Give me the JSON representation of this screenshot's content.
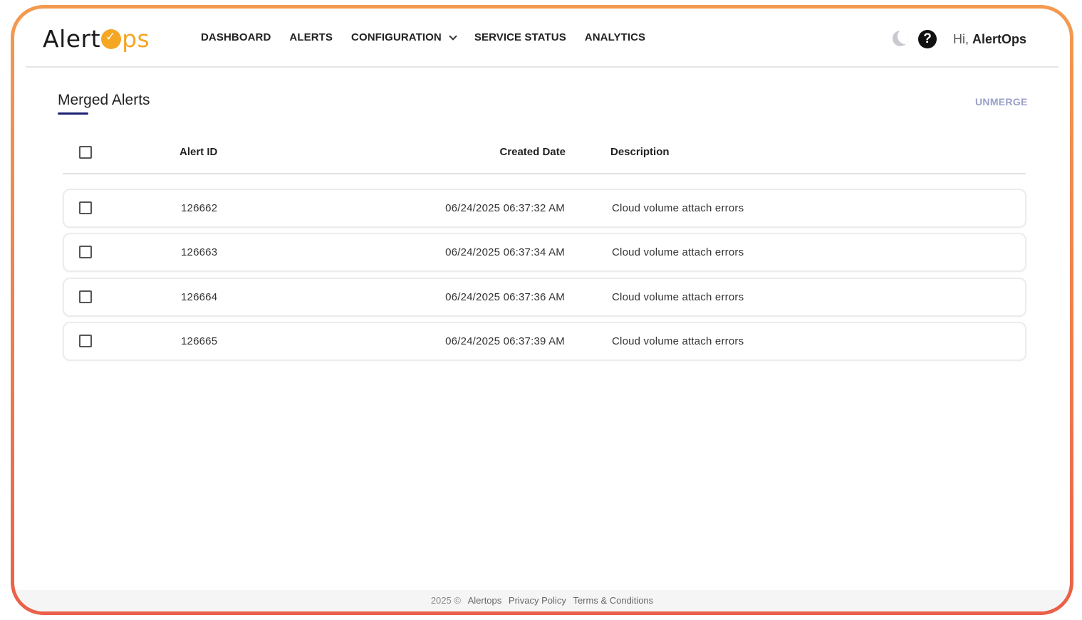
{
  "brand": {
    "logo_text_a": "Alert",
    "logo_text_ps": "ps"
  },
  "nav": {
    "dashboard": "DASHBOARD",
    "alerts": "ALERTS",
    "configuration": "CONFIGURATION",
    "service_status": "SERVICE STATUS",
    "analytics": "ANALYTICS"
  },
  "user": {
    "greeting": "Hi,",
    "name": "AlertOps"
  },
  "help_glyph": "?",
  "page": {
    "title": "Merged Alerts",
    "unmerge_label": "UNMERGE"
  },
  "table": {
    "headers": {
      "alert_id": "Alert ID",
      "created_date": "Created Date",
      "description": "Description"
    },
    "rows": [
      {
        "id": "126662",
        "date": "06/24/2025 06:37:32 AM",
        "description": "Cloud volume attach errors"
      },
      {
        "id": "126663",
        "date": "06/24/2025 06:37:34 AM",
        "description": "Cloud volume attach errors"
      },
      {
        "id": "126664",
        "date": "06/24/2025 06:37:36 AM",
        "description": "Cloud volume attach errors"
      },
      {
        "id": "126665",
        "date": "06/24/2025 06:37:39 AM",
        "description": "Cloud volume attach errors"
      }
    ]
  },
  "footer": {
    "year": "2025 ©",
    "company": "Alertops",
    "privacy": "Privacy Policy",
    "terms": "Terms & Conditions"
  },
  "colors": {
    "brand_orange": "#f5a623",
    "accent_navy": "#1a1f71",
    "unmerge": "#9aa0c8",
    "frame_top": "#f39a4f",
    "frame_bottom": "#ea6048"
  },
  "icons": {
    "theme_toggle": "moon-icon",
    "help": "help-icon",
    "dropdown": "chevron-down-icon"
  }
}
